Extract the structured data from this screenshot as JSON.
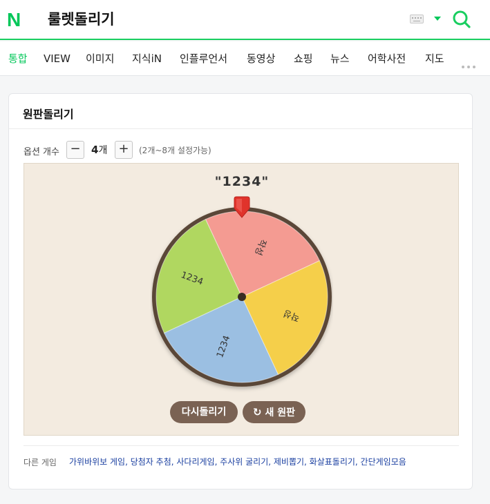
{
  "header": {
    "logo": "N",
    "query": "룰렛돌리기"
  },
  "tabs": [
    {
      "label": "통합",
      "active": true
    },
    {
      "label": "VIEW"
    },
    {
      "label": "이미지"
    },
    {
      "label": "지식iN"
    },
    {
      "label": "인플루언서"
    },
    {
      "label": "동영상"
    },
    {
      "label": "쇼핑"
    },
    {
      "label": "뉴스"
    },
    {
      "label": "어학사전"
    },
    {
      "label": "지도"
    }
  ],
  "card": {
    "title": "원판돌리기",
    "options_label": "옵션 개수",
    "minus": "−",
    "plus": "+",
    "count": "4",
    "count_unit": "개",
    "hint": "(2개~8개 설정가능)",
    "result": "\"1234\"",
    "respin_label": "다시돌리기",
    "new_label": "새 원판",
    "other_label": "다른 게임",
    "other_links": "가위바위보 게임, 당첨자 추첨, 사다리게임, 주사위 굴리기, 제비뽑기, 화살표돌리기, 간단게임모음"
  },
  "wheel": {
    "segments": [
      {
        "label": "1234",
        "color": "#b0d760"
      },
      {
        "label": "작성",
        "color": "#f49b92"
      },
      {
        "label": "작성",
        "color": "#f5cf4a"
      },
      {
        "label": "1234",
        "color": "#9bbfe2"
      }
    ],
    "rim_color": "#5a4637",
    "pointer_color": "#e0332b"
  },
  "colors": {
    "accent": "#03c75a",
    "button": "#7a6253",
    "stage_bg": "#f3ebe0"
  }
}
